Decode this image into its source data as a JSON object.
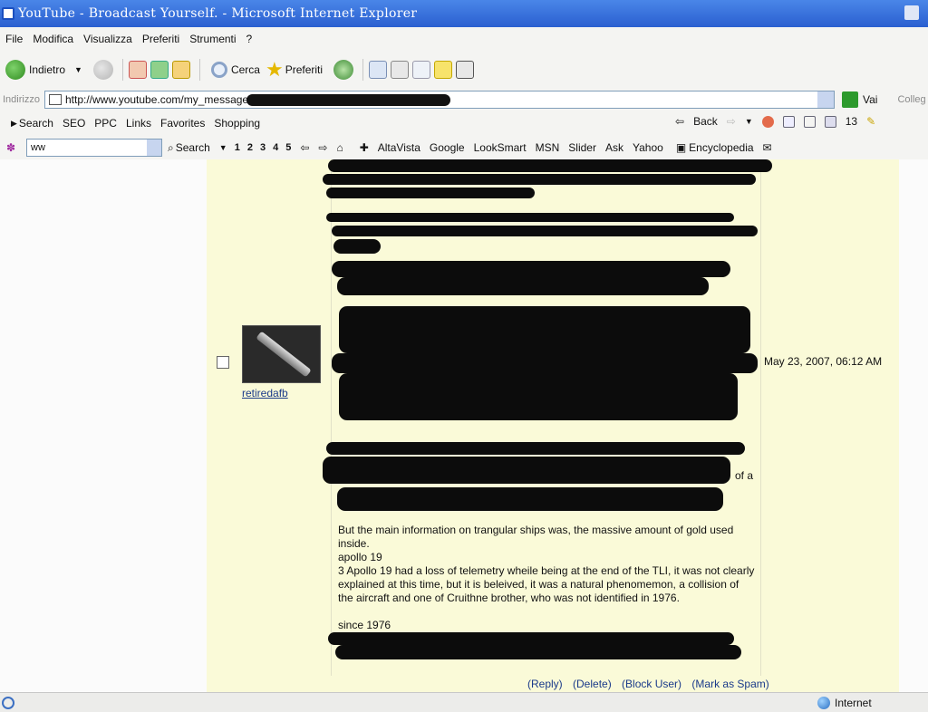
{
  "window": {
    "title": "YouTube - Broadcast Yourself. - Microsoft Internet Explorer"
  },
  "menu": [
    "File",
    "Modifica",
    "Visualizza",
    "Preferiti",
    "Strumenti",
    "?"
  ],
  "toolbar": {
    "back_label": "Indietro",
    "search_label": "Cerca",
    "favorites_label": "Preferiti"
  },
  "address": {
    "label": "Indirizzo",
    "url": "http://www.youtube.com/my_message",
    "go_label": "Vai",
    "links_label": "Colleg"
  },
  "links_toolbar": {
    "items": [
      "Search",
      "SEO",
      "PPC",
      "Links",
      "Favorites",
      "Shopping"
    ],
    "back_label": "Back",
    "count": "13"
  },
  "search_toolbar": {
    "query": "ww",
    "search_label": "Search",
    "pages": [
      "1",
      "2",
      "3",
      "4",
      "5"
    ],
    "engines": [
      "AltaVista",
      "Google",
      "LookSmart",
      "MSN",
      "Slider",
      "Ask",
      "Yahoo"
    ],
    "encyclopedia_label": "Encyclopedia"
  },
  "message": {
    "username": "retiredafb",
    "date": "May 23, 2007, 06:12 AM",
    "paragraph_1": "But the main information on trangular ships was, the massive amount of gold used inside.",
    "heading": "apollo 19",
    "paragraph_2": "3 Apollo 19 had a loss of telemetry wheile being at the end of the TLI, it was not clearly explained at this time, but it is beleived, it was a natural phenomemon, a collision of the aircraft and one of Cruithne brother, who was not identified in 1976.",
    "since": "since 1976",
    "fragment": "of a"
  },
  "actions": {
    "reply": "(Reply)",
    "delete": "(Delete)",
    "block": "(Block User)",
    "spam": "(Mark as Spam)"
  },
  "status": {
    "zone": "Internet"
  }
}
